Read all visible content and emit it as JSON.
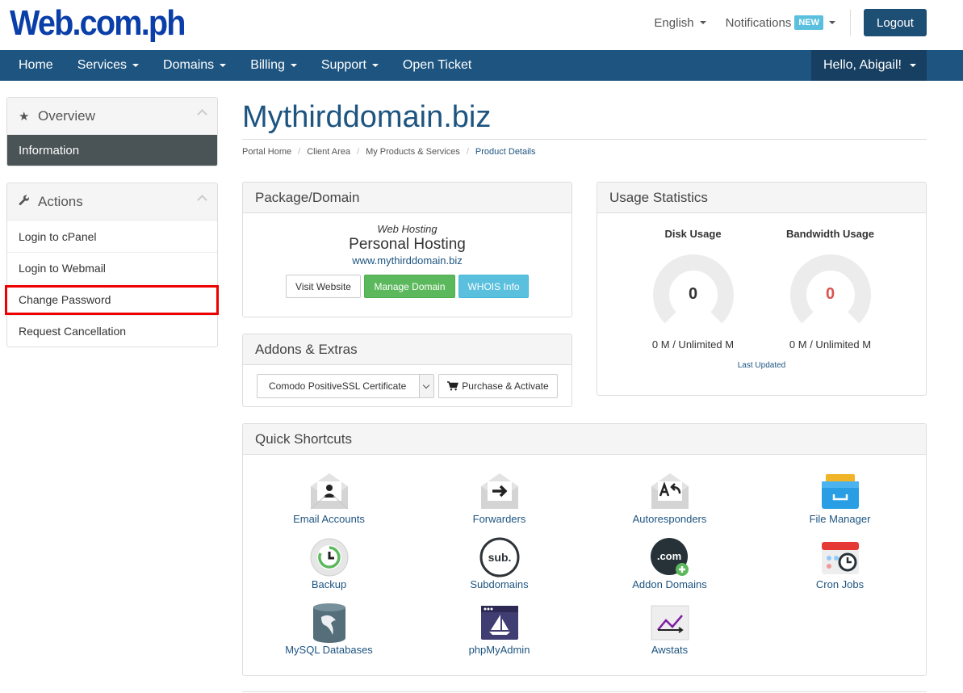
{
  "header": {
    "logo": "Web.com.ph",
    "language": "English",
    "notifications": "Notifications",
    "notifications_badge": "NEW",
    "logout": "Logout"
  },
  "nav": {
    "items": [
      "Home",
      "Services",
      "Domains",
      "Billing",
      "Support",
      "Open Ticket"
    ],
    "user": "Hello, Abigail!"
  },
  "sidebar": {
    "overview_title": "Overview",
    "overview_active": "Information",
    "actions_title": "Actions",
    "actions": [
      "Login to cPanel",
      "Login to Webmail",
      "Change Password",
      "Request Cancellation"
    ]
  },
  "page": {
    "title": "Mythirddomain.biz",
    "breadcrumb": [
      "Portal Home",
      "Client Area",
      "My Products & Services",
      "Product Details"
    ]
  },
  "package": {
    "heading": "Package/Domain",
    "type": "Web Hosting",
    "name": "Personal Hosting",
    "domain": "www.mythirddomain.biz",
    "btn_visit": "Visit Website",
    "btn_manage": "Manage Domain",
    "btn_whois": "WHOIS Info"
  },
  "addons": {
    "heading": "Addons & Extras",
    "selected": "Comodo PositiveSSL Certificate",
    "btn_purchase": "Purchase & Activate"
  },
  "usage": {
    "heading": "Usage Statistics",
    "disk_label": "Disk Usage",
    "disk_value": "0",
    "disk_amount": "0 M / Unlimited M",
    "bw_label": "Bandwidth Usage",
    "bw_value": "0",
    "bw_amount": "0 M / Unlimited M",
    "last_updated": "Last Updated",
    "colors": {
      "disk_value": "#333333",
      "bw_value": "#d9534f"
    }
  },
  "shortcuts": {
    "heading": "Quick Shortcuts",
    "items": [
      {
        "label": "Email Accounts",
        "icon": "email-accounts-icon"
      },
      {
        "label": "Forwarders",
        "icon": "forwarders-icon"
      },
      {
        "label": "Autoresponders",
        "icon": "autoresponders-icon"
      },
      {
        "label": "File Manager",
        "icon": "file-manager-icon"
      },
      {
        "label": "Backup",
        "icon": "backup-icon"
      },
      {
        "label": "Subdomains",
        "icon": "subdomains-icon"
      },
      {
        "label": "Addon Domains",
        "icon": "addon-domains-icon"
      },
      {
        "label": "Cron Jobs",
        "icon": "cron-jobs-icon"
      },
      {
        "label": "MySQL Databases",
        "icon": "mysql-databases-icon"
      },
      {
        "label": "phpMyAdmin",
        "icon": "phpmyadmin-icon"
      },
      {
        "label": "Awstats",
        "icon": "awstats-icon"
      }
    ],
    "icon_text": {
      "subdomains": "sub.",
      "addon_domains": ".com"
    }
  },
  "colors": {
    "brand": "#1d5480",
    "nav_bg": "#1d5480",
    "highlight": "#ee0000"
  }
}
